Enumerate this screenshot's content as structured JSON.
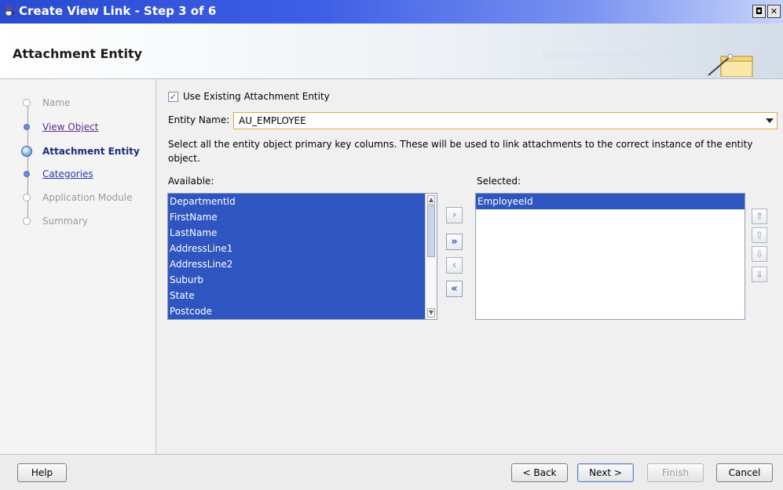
{
  "window": {
    "title": "Create View Link - Step 3 of 6",
    "maximize_glyph": "◘",
    "close_glyph": "✕",
    "app_icon": "coffee-cup-icon"
  },
  "header": {
    "title": "Attachment Entity",
    "binary_watermark": "0101010101010101010101010101010",
    "wizard_icon": "folder-wand-icon"
  },
  "nav": {
    "steps": [
      {
        "label": "Name",
        "state": "disabled"
      },
      {
        "label": "View Object",
        "state": "visited"
      },
      {
        "label": "Attachment Entity",
        "state": "current"
      },
      {
        "label": "Categories",
        "state": "link"
      },
      {
        "label": "Application Module",
        "state": "disabled"
      },
      {
        "label": "Summary",
        "state": "disabled"
      }
    ]
  },
  "form": {
    "use_existing_label": "Use Existing Attachment Entity",
    "use_existing_checked": true,
    "entity_name_label": "Entity Name:",
    "entity_name_value": "AU_EMPLOYEE",
    "description": "Select all the entity object primary key columns. These will be used to link attachments to the correct instance of the entity object.",
    "available_label": "Available:",
    "selected_label": "Selected:",
    "available_items": [
      "DepartmentId",
      "FirstName",
      "LastName",
      "AddressLine1",
      "AddressLine2",
      "Suburb",
      "State",
      "Postcode"
    ],
    "selected_items": [
      "EmployeeId"
    ]
  },
  "shuttle": {
    "move_one": "›",
    "move_all": "»",
    "remove_one": "‹",
    "remove_all": "«"
  },
  "order": {
    "top": "⇑",
    "up": "⇧",
    "down": "⇩",
    "bottom": "⇓"
  },
  "footer": {
    "help": "Help",
    "back": "< Back",
    "next": "Next >",
    "finish": "Finish",
    "cancel": "Cancel"
  }
}
